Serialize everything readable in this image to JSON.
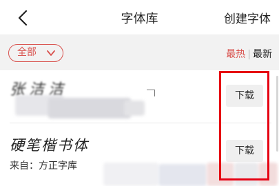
{
  "header": {
    "back_icon": "chevron-left-icon",
    "title": "字体库",
    "create_label": "创建字体"
  },
  "filter": {
    "all_label": "全部",
    "sort_hot": "最热",
    "sort_new": "最新",
    "sort_separator": "|"
  },
  "fonts": [
    {
      "preview": "张洁洁",
      "source": "",
      "download_label": "下载"
    },
    {
      "preview": "硬笔楷书体",
      "source": "来自：方正字库",
      "download_label": "下载"
    }
  ],
  "colors": {
    "accent": "#d9534f",
    "highlight_box": "#e60012",
    "filter_bg": "#f2f2f2"
  }
}
